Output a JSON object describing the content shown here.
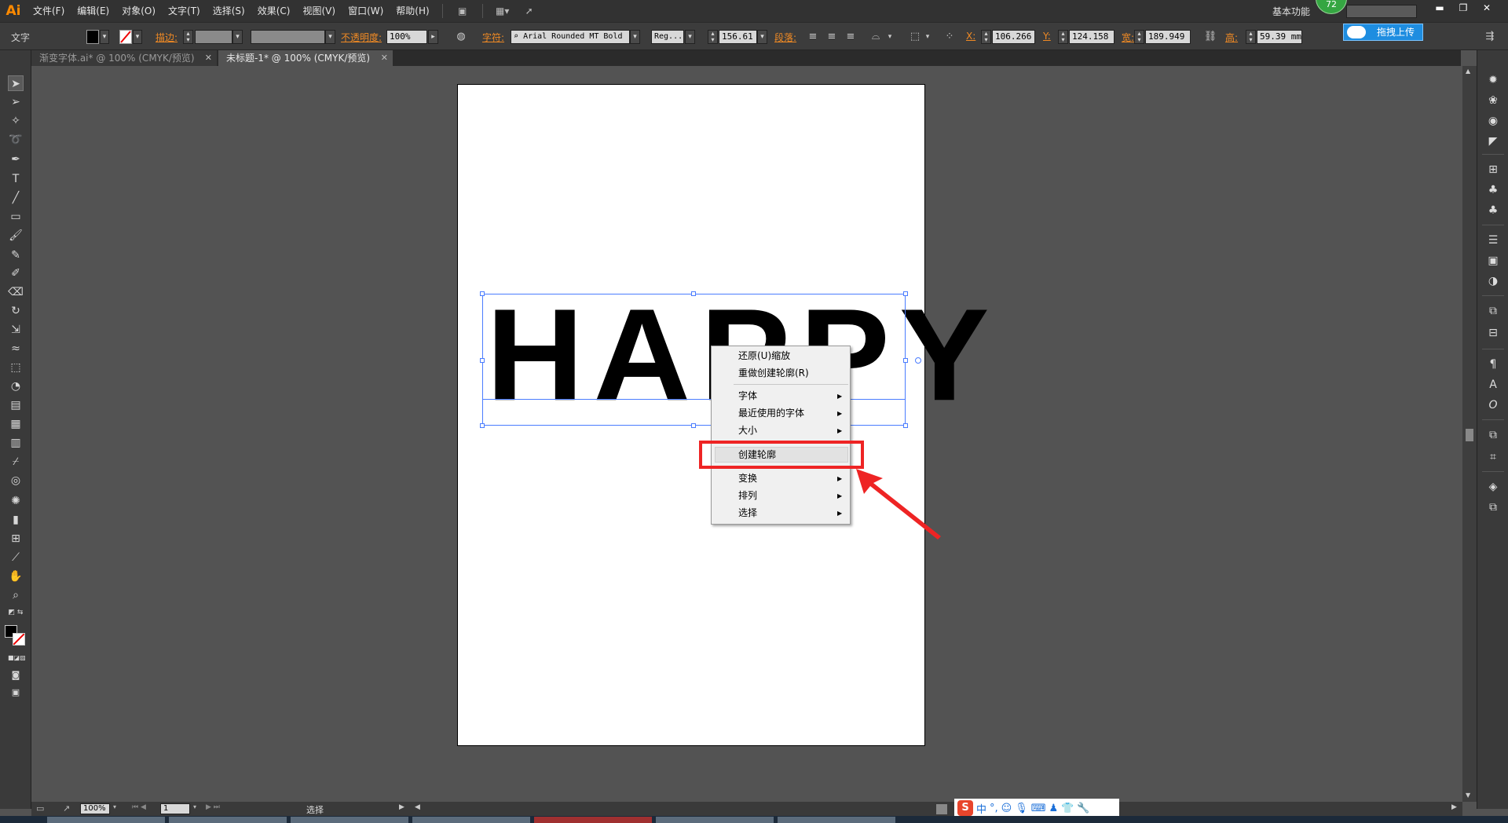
{
  "app": {
    "logo": "Ai"
  },
  "menu": [
    "文件(F)",
    "编辑(E)",
    "对象(O)",
    "文字(T)",
    "选择(S)",
    "效果(C)",
    "视图(V)",
    "窗口(W)",
    "帮助(H)"
  ],
  "header": {
    "workspace": "基本功能",
    "badge_count": "72",
    "upload_label": "拖拽上传"
  },
  "controlbar": {
    "object_type": "文字",
    "stroke_label": "描边:",
    "opacity_label": "不透明度:",
    "opacity_value": "100%",
    "char_label": "字符:",
    "font_name": "Arial Rounded MT Bold",
    "font_style": "Reg...",
    "font_size": "156.61",
    "para_label": "段落:",
    "x_label": "X:",
    "x_value": "106.266",
    "y_label": "Y:",
    "y_value": "124.158",
    "w_label": "宽:",
    "w_value": "189.949",
    "h_label": "高:",
    "h_value": "59.39 mm"
  },
  "tabs": [
    {
      "label": "渐变字体.ai* @ 100% (CMYK/预览)",
      "active": false
    },
    {
      "label": "未标题-1* @ 100% (CMYK/预览)",
      "active": true
    }
  ],
  "canvas": {
    "text": "HAPPY"
  },
  "context_menu": {
    "items": [
      {
        "label": "还原(U)缩放",
        "submenu": false
      },
      {
        "label": "重做创建轮廓(R)",
        "submenu": false
      },
      {
        "label": "字体",
        "submenu": true
      },
      {
        "label": "最近使用的字体",
        "submenu": true
      },
      {
        "label": "大小",
        "submenu": true
      },
      {
        "label": "创建轮廓",
        "submenu": false,
        "highlighted": true
      },
      {
        "label": "变换",
        "submenu": true
      },
      {
        "label": "排列",
        "submenu": true
      },
      {
        "label": "选择",
        "submenu": true
      }
    ],
    "highlight_color": "#ee2424"
  },
  "statusbar": {
    "zoom": "100%",
    "page": "1",
    "tool_name": "选择"
  },
  "ime": {
    "lang": "中"
  }
}
